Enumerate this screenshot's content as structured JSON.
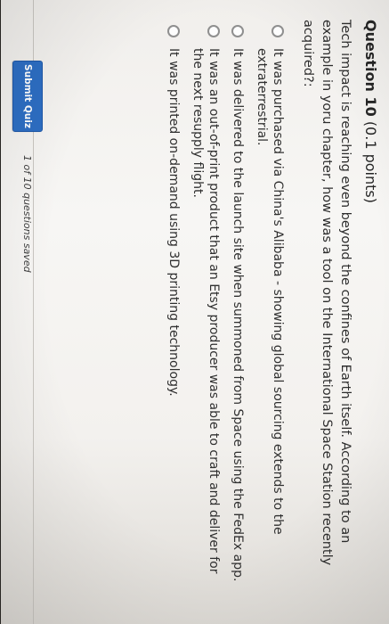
{
  "question": {
    "number_label": "Question 10",
    "points_label": "(0.1 points)",
    "prompt": "Tech impact is reaching even beyond the confines of Earth itself. According to an example in yoru chapter, how was a tool on the International Space Station recently acquired?:",
    "options": [
      {
        "label": "It was purchased via China's Alibaba - showing global sourcing extends to the extraterrestrial."
      },
      {
        "label": "It was delivered to the launch site when summoned from Space using the FedEx app."
      },
      {
        "label": "It was an out-of-print product that an Etsy producer was able to craft and deliver for the next resupply flight."
      },
      {
        "label": "It was printed on-demand using 3D printing technology."
      }
    ]
  },
  "footer": {
    "submit_label": "Submit Quiz",
    "save_status": "1 of 10 questions saved"
  },
  "colors": {
    "accent": "#2d6ec3",
    "page_background": "#f5f4f2"
  }
}
